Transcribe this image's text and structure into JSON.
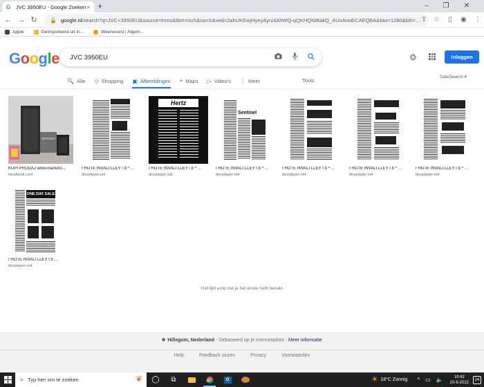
{
  "browser": {
    "tab_title": "JVC 3950EU - Google Zoeken",
    "tab_close": "×",
    "new_tab": "+",
    "url_host": "google.nl",
    "url_rest": "/search?q=JVC+3950EU&source=lnms&tbm=isch&sa=X&ved=2ahUKEwjHyeyAyrz4AhWQ-qQKHQNiBakQ_AUoAnoECAEQBA&biw=1280&bih=...",
    "bookmarks": [
      {
        "label": "Apple",
        "color": "#444444"
      },
      {
        "label": "Geïmporteerd uit In...",
        "color": "#f4c20d"
      },
      {
        "label": "Weerwoord | Algem...",
        "color": "#f29900"
      }
    ]
  },
  "search": {
    "query": "JVC 3950EU",
    "logo_letters": [
      "G",
      "o",
      "o",
      "g",
      "l",
      "e"
    ],
    "signin_label": "Inloggen",
    "safesearch_label": "SafeSearch ▾",
    "tools_label": "Tools",
    "tabs": [
      {
        "label": "Alle",
        "icon": "🔍"
      },
      {
        "label": "Shopping",
        "icon": "◇"
      },
      {
        "label": "Afbeeldingen",
        "icon": "▣"
      },
      {
        "label": "Maps",
        "icon": "⌖"
      },
      {
        "label": "Video's",
        "icon": "▷"
      },
      {
        "label": "Meer",
        "icon": "⋮"
      }
    ]
  },
  "results": [
    {
      "caption": "KUPI PRODAJ www.market3...",
      "source": "facebook.com"
    },
    {
      "caption": "I HOTE INVALI LLEY I b ^ ...",
      "source": "docplayer.net"
    },
    {
      "caption": "I HOTE INVALI LLEY I b ^ ...",
      "source": "docplayer.net"
    },
    {
      "caption": "I HOTE INVALI LLEY I b ^ ...",
      "source": "docplayer.net"
    },
    {
      "caption": "I HOTE INVALI LLEY I b ^ ...",
      "source": "docplayer.net"
    },
    {
      "caption": "I HOTE INVALI LLEY I b ^ ...",
      "source": "docplayer.net"
    },
    {
      "caption": "I HOTE INVALI LLEY I b ^ ...",
      "source": "docplayer.net"
    },
    {
      "caption": "I HOTE INVALI LLEY I b ...",
      "source": "docplayer.net"
    }
  ],
  "newspaper_headlines": [
    "Hertz",
    "Sentinel",
    "ONE DAY SALE"
  ],
  "end_message": "Het lijkt erop dat je het einde hebt bereikt",
  "footer": {
    "location": "Hillegom, Nederland",
    "location_suffix": " - Gebaseerd op je internetadres - ",
    "more_info": "Meer informatie",
    "links": [
      "Help",
      "Feedback sturen",
      "Privacy",
      "Voorwaarden"
    ]
  },
  "taskbar": {
    "search_placeholder": "Typ hier om te zoeken",
    "weather": "18°C  Zonnig",
    "time": "19:42",
    "date": "20-6-2022",
    "notifications": "24"
  },
  "colors": {
    "accent": "#1a73e8",
    "link": "#1a0dab"
  }
}
